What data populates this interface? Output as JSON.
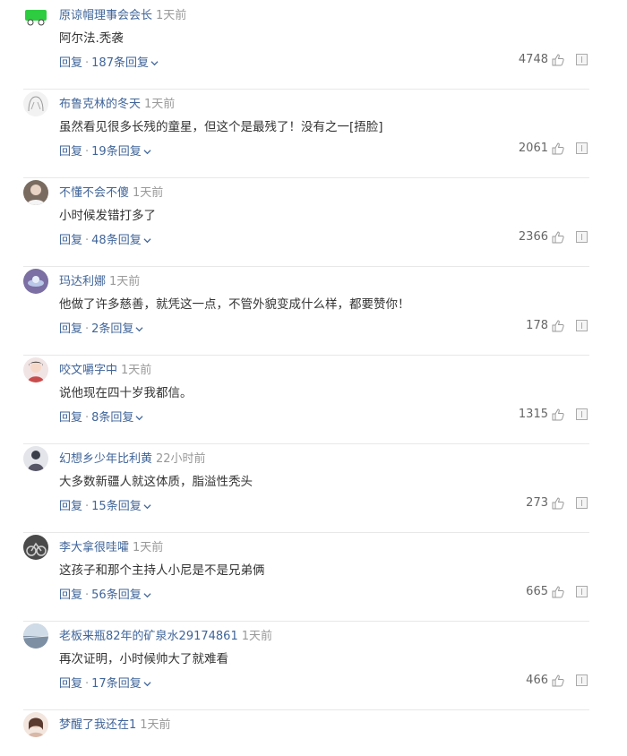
{
  "comments": [
    {
      "user": "原谅帽理事会会长",
      "time": "1天前",
      "text": "阿尔法.秃袭",
      "reply_label": "回复",
      "replies": "187条回复",
      "likes": "4748",
      "avatar_color": "#2ecc40"
    },
    {
      "user": "布鲁克林的冬天",
      "time": "1天前",
      "text": "虽然看见很多长残的童星，但这个是最残了！没有之一[捂脸]",
      "reply_label": "回复",
      "replies": "19条回复",
      "likes": "2061",
      "avatar_color": "#e6e6e6"
    },
    {
      "user": "不懂不会不傻",
      "time": "1天前",
      "text": "小时候发错打多了",
      "reply_label": "回复",
      "replies": "48条回复",
      "likes": "2366",
      "avatar_color": "#7a6b60"
    },
    {
      "user": "玛达利娜",
      "time": "1天前",
      "text": "他做了许多慈善，就凭这一点，不管外貌变成什么样，都要赞你！",
      "reply_label": "回复",
      "replies": "2条回复",
      "likes": "178",
      "avatar_color": "#7b6fa3"
    },
    {
      "user": "咬文嚼字中",
      "time": "1天前",
      "text": "说他现在四十岁我都信。",
      "reply_label": "回复",
      "replies": "8条回复",
      "likes": "1315",
      "avatar_color": "#c98b8b"
    },
    {
      "user": "幻想乡少年比利黄",
      "time": "22小时前",
      "text": "大多数新疆人就这体质，脂溢性秃头",
      "reply_label": "回复",
      "replies": "15条回复",
      "likes": "273",
      "avatar_color": "#555566"
    },
    {
      "user": "李大拿很哇嚯",
      "time": "1天前",
      "text": "这孩子和那个主持人小尼是不是兄弟俩",
      "reply_label": "回复",
      "replies": "56条回复",
      "likes": "665",
      "avatar_color": "#4a4a4a"
    },
    {
      "user": "老板来瓶82年的矿泉水29174861",
      "time": "1天前",
      "text": "再次证明，小时候帅大了就难看",
      "reply_label": "回复",
      "replies": "17条回复",
      "likes": "466",
      "avatar_color": "#8fa3b8"
    },
    {
      "user": "梦醒了我还在1",
      "time": "1天前",
      "text": "",
      "reply_label": "",
      "replies": "",
      "likes": "",
      "avatar_color": "#c9a89a"
    }
  ]
}
